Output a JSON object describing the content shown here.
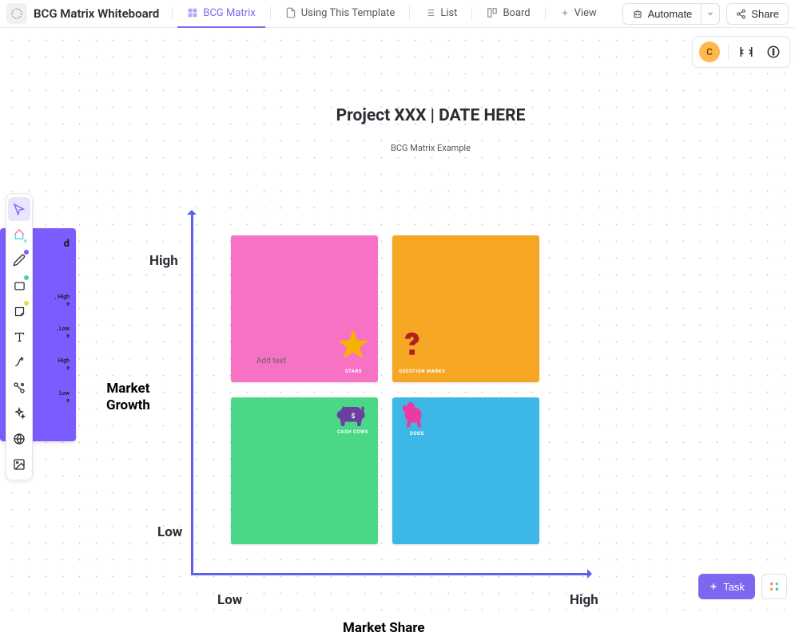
{
  "page_title": "BCG Matrix Whiteboard",
  "tabs": [
    {
      "label": "BCG Matrix",
      "active": true
    },
    {
      "label": "Using This Template",
      "active": false
    },
    {
      "label": "List",
      "active": false
    },
    {
      "label": "Board",
      "active": false
    },
    {
      "label": "View",
      "active": false
    }
  ],
  "topbar": {
    "automate": "Automate",
    "share": "Share"
  },
  "user": {
    "initial": "C"
  },
  "chart": {
    "title": "Project XXX | DATE HERE",
    "subtitle": "BCG Matrix Example",
    "y_axis_label_1": "Market",
    "y_axis_label_2": "Growth",
    "y_high": "High",
    "y_low": "Low",
    "x_axis_label": "Market Share",
    "x_low": "Low",
    "x_high": "High"
  },
  "quadrants": {
    "stars": {
      "label": "STARS",
      "placeholder": "Add text",
      "color": "#f772c4"
    },
    "question_marks": {
      "label": "QUESTION MARKS",
      "color": "#f5a623"
    },
    "cash_cows": {
      "label": "CASH COWS",
      "color": "#4ad887"
    },
    "dogs": {
      "label": "DOGS",
      "color": "#3db8e6"
    }
  },
  "legend": {
    "title": "d",
    "items": [
      {
        "color": "#7b5cff",
        "text": ""
      },
      {
        "color": "#4ad887",
        "text": ", High\ne"
      },
      {
        "color": "#f5d547",
        "text": ", Low\ne"
      },
      {
        "color": "#ff8a47",
        "text": "High\ne"
      },
      {
        "color": "#ff5a5a",
        "text": "Low\ne"
      }
    ]
  },
  "bottom_right": {
    "task_label": "Task"
  },
  "chart_data": {
    "type": "table",
    "title": "BCG Matrix",
    "xlabel": "Market Share",
    "ylabel": "Market Growth",
    "categories_x": [
      "Low",
      "High"
    ],
    "categories_y": [
      "High",
      "Low"
    ],
    "cells": [
      {
        "x": "Low",
        "y": "High",
        "label": "STARS",
        "color": "#f772c4",
        "icon": "star"
      },
      {
        "x": "High",
        "y": "High",
        "label": "QUESTION MARKS",
        "color": "#f5a623",
        "icon": "question"
      },
      {
        "x": "Low",
        "y": "Low",
        "label": "CASH COWS",
        "color": "#4ad887",
        "icon": "cow"
      },
      {
        "x": "High",
        "y": "Low",
        "label": "DOGS",
        "color": "#3db8e6",
        "icon": "dog"
      }
    ]
  }
}
